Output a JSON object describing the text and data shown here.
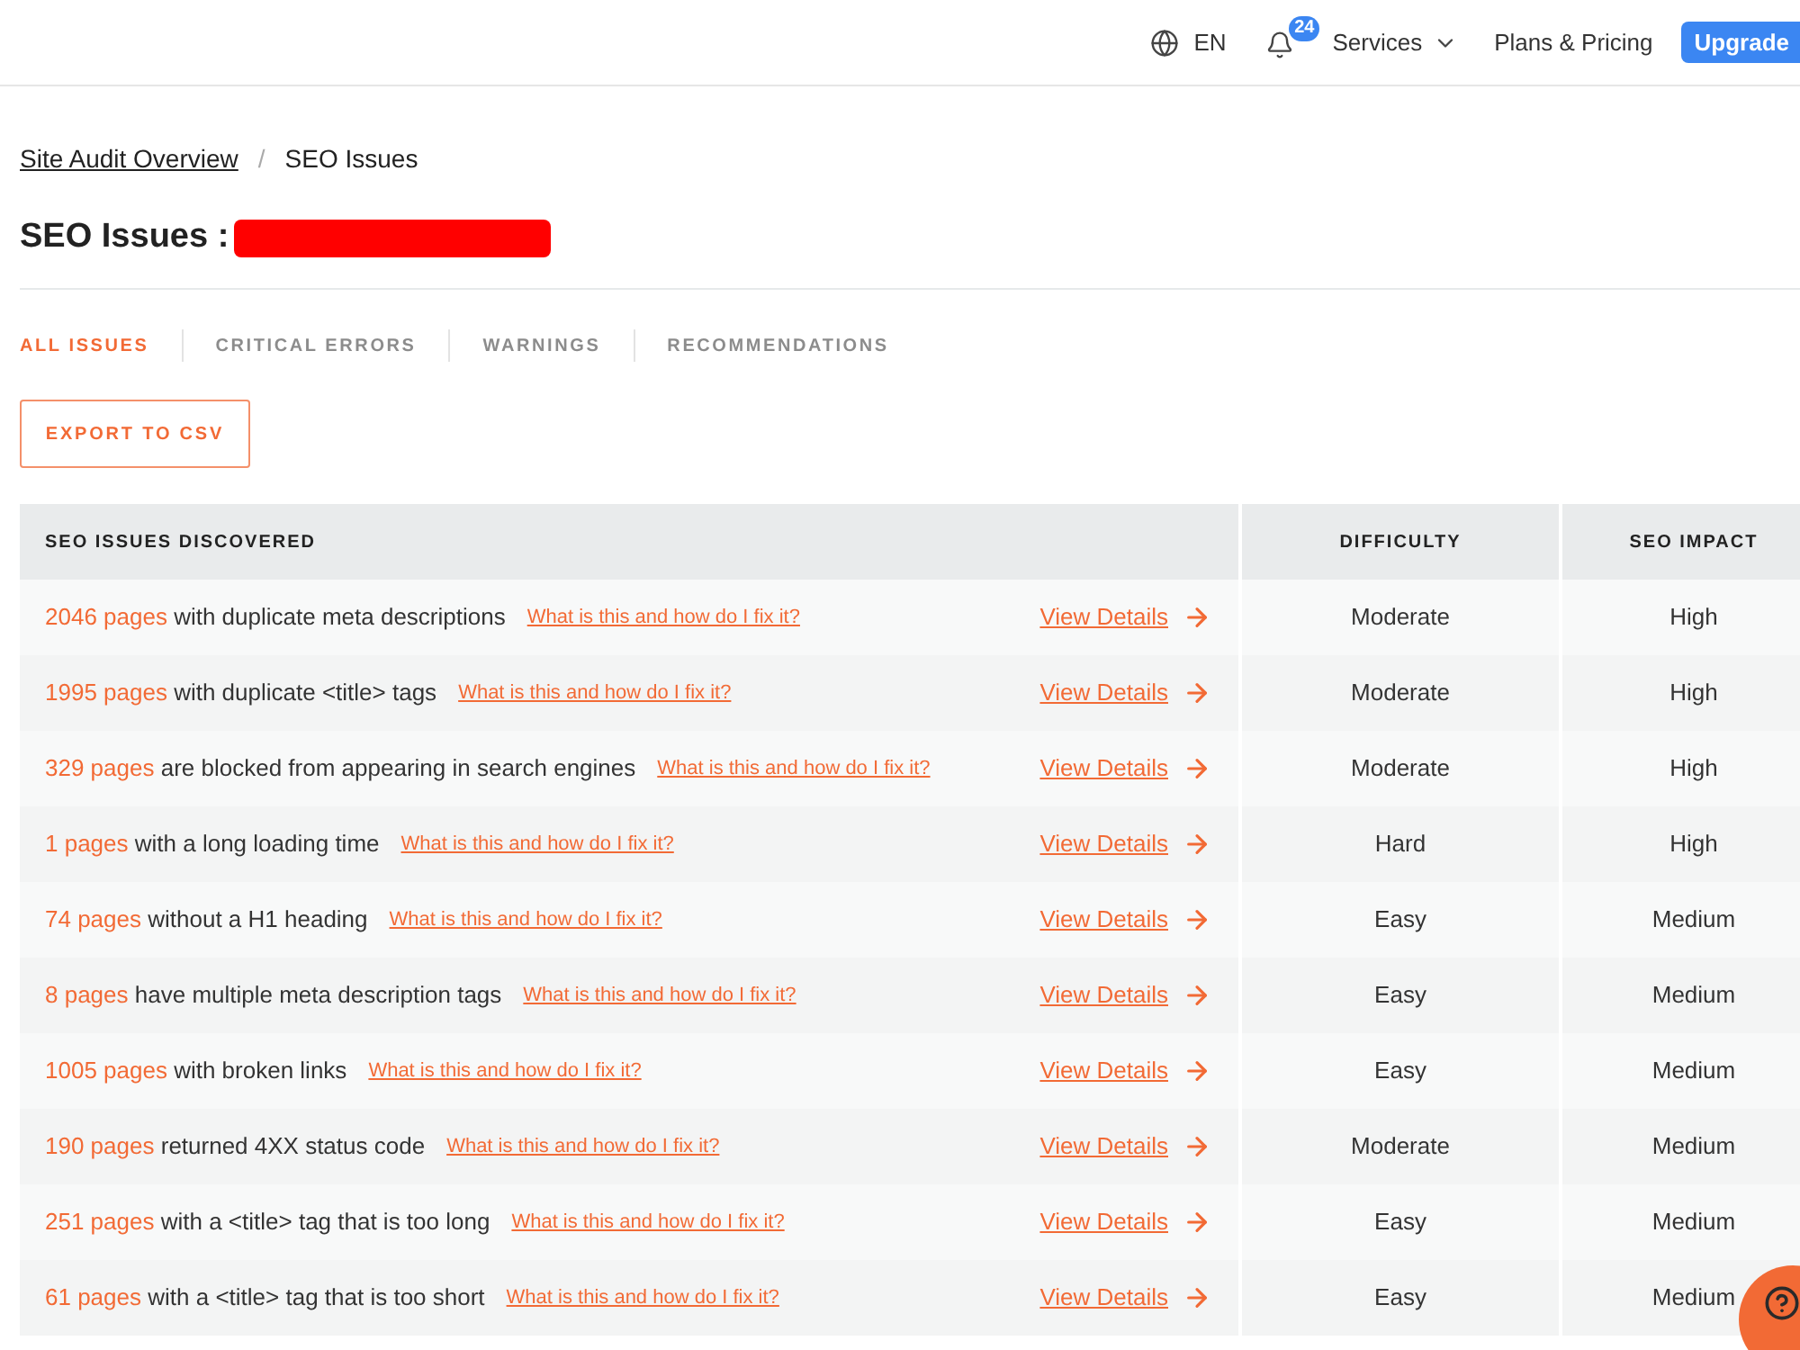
{
  "top_nav": {
    "language": "EN",
    "notification_count": "24",
    "services": "Services",
    "plans": "Plans & Pricing",
    "upgrade": "Upgrade"
  },
  "breadcrumb": {
    "items": [
      {
        "label": "Site Audit Overview",
        "link": true
      },
      {
        "label": "SEO Issues",
        "link": false
      }
    ],
    "separator": "/"
  },
  "title": {
    "text": "SEO Issues :",
    "redacted": true
  },
  "tabs": [
    {
      "label": "ALL ISSUES",
      "selected": true
    },
    {
      "label": "CRITICAL ERRORS",
      "selected": false
    },
    {
      "label": "WARNINGS",
      "selected": false
    },
    {
      "label": "RECOMMENDATIONS",
      "selected": false
    }
  ],
  "export_button": "EXPORT TO CSV",
  "table": {
    "columns": [
      "SEO ISSUES DISCOVERED",
      "DIFFICULTY",
      "SEO IMPACT"
    ],
    "rows": [
      {
        "count": "2046 pages",
        "description": "with duplicate meta descriptions",
        "help_link": "What is this and how do I fix it?",
        "details_link": "View Details",
        "difficulty": "Moderate",
        "impact": "High"
      },
      {
        "count": "1995 pages",
        "description": "with duplicate <title> tags",
        "help_link": "What is this and how do I fix it?",
        "details_link": "View Details",
        "difficulty": "Moderate",
        "impact": "High"
      },
      {
        "count": "329 pages",
        "description": "are blocked from appearing in search engines",
        "help_link": "What is this and how do I fix it?",
        "details_link": "View Details",
        "difficulty": "Moderate",
        "impact": "High"
      },
      {
        "count": "1 pages",
        "description": "with a long loading time",
        "help_link": "What is this and how do I fix it?",
        "details_link": "View Details",
        "difficulty": "Hard",
        "impact": "High"
      },
      {
        "count": "74 pages",
        "description": "without a H1 heading",
        "help_link": "What is this and how do I fix it?",
        "details_link": "View Details",
        "difficulty": "Easy",
        "impact": "Medium"
      },
      {
        "count": "8 pages",
        "description": "have multiple meta description tags",
        "help_link": "What is this and how do I fix it?",
        "details_link": "View Details",
        "difficulty": "Easy",
        "impact": "Medium"
      },
      {
        "count": "1005 pages",
        "description": "with broken links",
        "help_link": "What is this and how do I fix it?",
        "details_link": "View Details",
        "difficulty": "Easy",
        "impact": "Medium"
      },
      {
        "count": "190 pages",
        "description": "returned 4XX status code",
        "help_link": "What is this and how do I fix it?",
        "details_link": "View Details",
        "difficulty": "Moderate",
        "impact": "Medium"
      },
      {
        "count": "251 pages",
        "description": "with a <title> tag that is too long",
        "help_link": "What is this and how do I fix it?",
        "details_link": "View Details",
        "difficulty": "Easy",
        "impact": "Medium"
      },
      {
        "count": "61 pages",
        "description": "with a <title> tag that is too short",
        "help_link": "What is this and how do I fix it?",
        "details_link": "View Details",
        "difficulty": "Easy",
        "impact": "Medium"
      }
    ]
  }
}
